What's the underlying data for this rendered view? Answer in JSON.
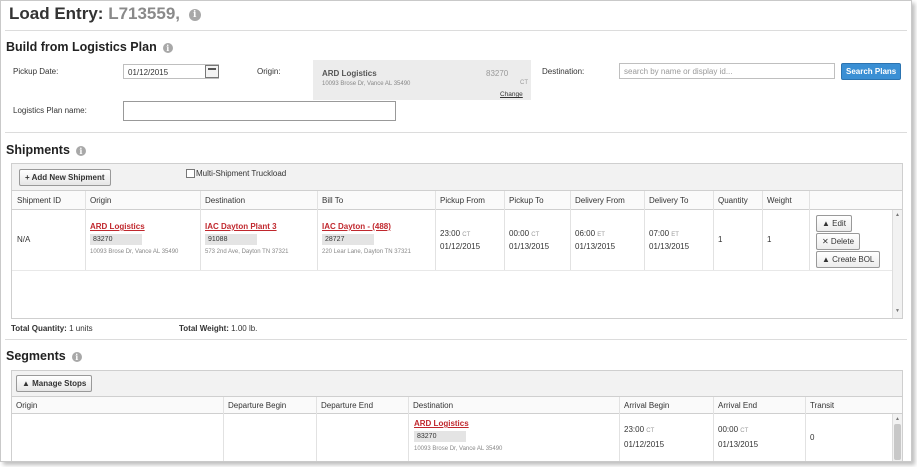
{
  "header": {
    "title": "Load Entry:",
    "load_id": "L713559,",
    "info_icon": "info-icon"
  },
  "plan": {
    "heading": "Build from Logistics Plan",
    "pickup_date_label": "Pickup Date:",
    "pickup_date_value": "01/12/2015",
    "origin_label": "Origin:",
    "origin_name": "ARD Logistics",
    "origin_code": "83270",
    "origin_address": "10093 Brose Dr, Vance AL 35490",
    "origin_tz": "CT",
    "origin_change": "Change",
    "destination_label": "Destination:",
    "destination_placeholder": "search by name or display id...",
    "search_button": "Search Plans",
    "plan_name_label": "Logistics Plan name:",
    "plan_name_value": ""
  },
  "shipments": {
    "heading": "Shipments",
    "add_button": "+ Add New Shipment",
    "multi_label": "Multi-Shipment Truckload",
    "columns": [
      "Shipment ID",
      "Origin",
      "Destination",
      "Bill To",
      "Pickup From",
      "Pickup To",
      "Delivery From",
      "Delivery To",
      "Quantity",
      "Weight"
    ],
    "row": {
      "id": "N/A",
      "origin_name": "ARD Logistics",
      "origin_code": "83270",
      "origin_addr": "10093 Brose Dr, Vance AL 35490",
      "dest_name": "IAC Dayton Plant 3",
      "dest_code": "91088",
      "dest_addr": "573 2nd Ave, Dayton TN 37321",
      "bill_name": "IAC Dayton - (488)",
      "bill_code": "28727",
      "bill_addr": "220 Lear Lane, Dayton TN 37321",
      "pickup_from_time": "23:00",
      "pickup_from_tz": "CT",
      "pickup_from_date": "01/12/2015",
      "pickup_to_time": "00:00",
      "pickup_to_tz": "CT",
      "pickup_to_date": "01/13/2015",
      "delivery_from_time": "06:00",
      "delivery_from_tz": "ET",
      "delivery_from_date": "01/13/2015",
      "delivery_to_time": "07:00",
      "delivery_to_tz": "ET",
      "delivery_to_date": "01/13/2015",
      "quantity": "1",
      "weight": "1"
    },
    "actions": {
      "edit": "▲ Edit",
      "delete": "✕ Delete",
      "create_bol": "▲ Create BOL"
    },
    "total_quantity_label": "Total Quantity:",
    "total_quantity_value": "1 units",
    "total_weight_label": "Total Weight:",
    "total_weight_value": "1.00 lb."
  },
  "segments": {
    "heading": "Segments",
    "manage_button": "▲ Manage Stops",
    "columns": [
      "Origin",
      "Departure Begin",
      "Departure End",
      "Destination",
      "Arrival Begin",
      "Arrival End",
      "Transit"
    ],
    "row": {
      "dest_name": "ARD Logistics",
      "dest_code": "83270",
      "dest_addr": "10093 Brose Dr, Vance AL 35490",
      "arrival_begin_time": "23:00",
      "arrival_begin_tz": "CT",
      "arrival_begin_date": "01/12/2015",
      "arrival_end_time": "00:00",
      "arrival_end_tz": "CT",
      "arrival_end_date": "01/13/2015",
      "transit": "0"
    }
  }
}
